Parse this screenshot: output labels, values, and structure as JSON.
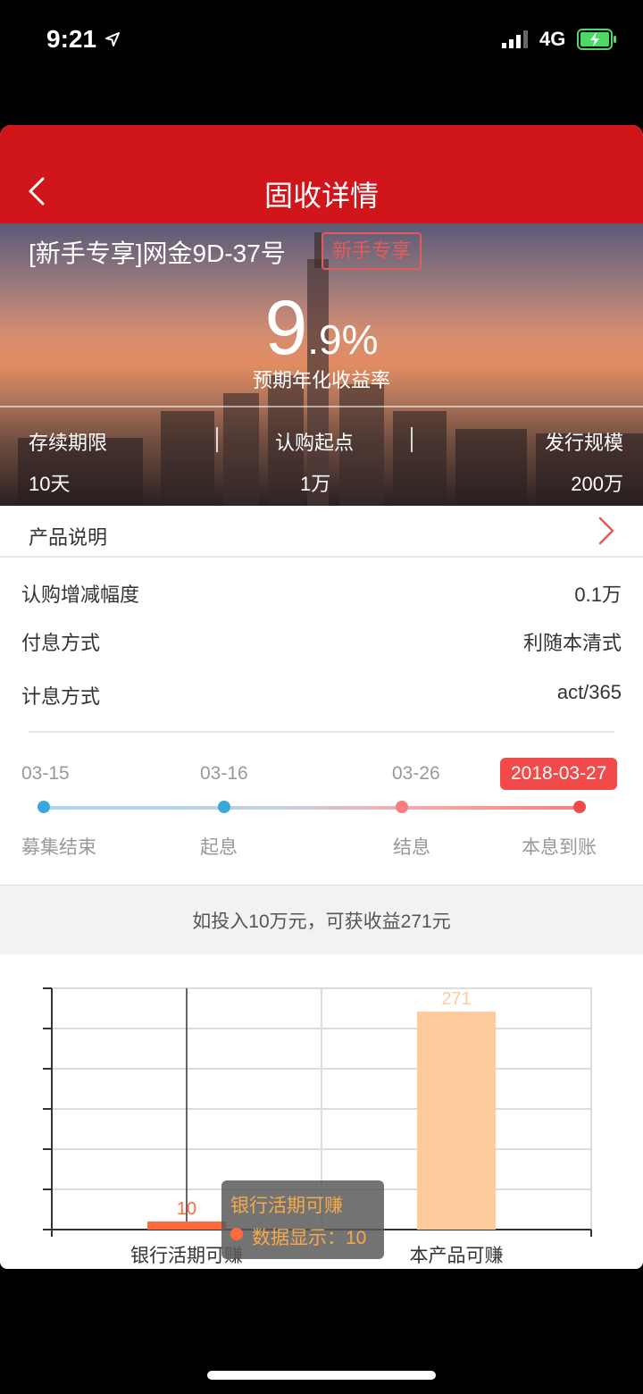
{
  "status_bar": {
    "time": "9:21",
    "network": "4G"
  },
  "nav": {
    "title": "固收详情"
  },
  "product": {
    "name": "[新手专享]网金9D-37号",
    "tag": "新手专享"
  },
  "rate": {
    "int": "9",
    "dec": ".9%",
    "label": "预期年化收益率"
  },
  "stats": [
    {
      "label": "存续期限",
      "value": "10天"
    },
    {
      "label": "认购起点",
      "value": "1万"
    },
    {
      "label": "发行规模",
      "value": "200万"
    }
  ],
  "description": {
    "label": "产品说明"
  },
  "info": [
    {
      "key": "认购增减幅度",
      "value": "0.1万"
    },
    {
      "key": "付息方式",
      "value": "利随本清式"
    },
    {
      "key": "计息方式",
      "value": "act/365"
    }
  ],
  "timeline": {
    "dates": [
      "03-15",
      "03-16",
      "03-26",
      "2018-03-27"
    ],
    "labels": [
      "募集结束",
      "起息",
      "结息",
      "本息到账"
    ]
  },
  "yield_text": "如投入10万元，可获收益271元",
  "chart_data": {
    "type": "bar",
    "categories": [
      "银行活期可赚",
      "本产品可赚"
    ],
    "values": [
      10,
      271
    ],
    "colors": [
      "#ff6a3d",
      "#fdcb9c"
    ],
    "title": "",
    "xlabel": "",
    "ylabel": "",
    "ylim": [
      0,
      300
    ],
    "grid": true
  },
  "tooltip": {
    "title": "银行活期可赚",
    "text": "数据显示：10"
  },
  "colors": {
    "brand_red": "#d1161b",
    "accent_red": "#f04a4a"
  }
}
